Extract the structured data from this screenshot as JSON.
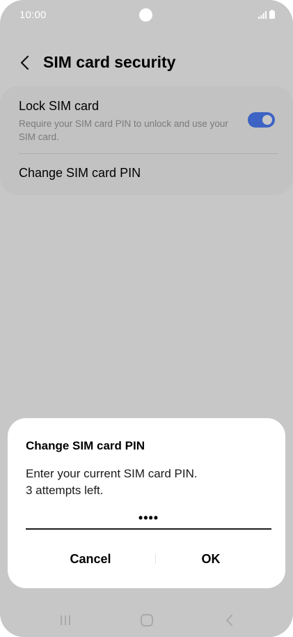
{
  "status_bar": {
    "time": "10:00",
    "signal_icon": "signal-icon",
    "battery_icon": "battery-icon"
  },
  "header": {
    "back_icon": "chevron-left-icon",
    "title": "SIM card security"
  },
  "settings": {
    "lock_sim": {
      "title": "Lock SIM card",
      "subtitle": "Require your SIM card PIN to unlock and use your SIM card.",
      "enabled": true
    },
    "change_pin": {
      "label": "Change SIM card PIN"
    }
  },
  "dialog": {
    "title": "Change SIM card PIN",
    "message_line1": "Enter your current SIM card PIN.",
    "message_line2": "3 attempts left.",
    "pin_value": "••••",
    "cancel_label": "Cancel",
    "ok_label": "OK"
  },
  "nav_bar": {
    "recents_icon": "recents-icon",
    "home_icon": "home-icon",
    "back_icon": "back-icon"
  },
  "colors": {
    "toggle_on": "#3d63c4",
    "scrim_background": "#c7c7c7",
    "dialog_background": "#ffffff"
  }
}
